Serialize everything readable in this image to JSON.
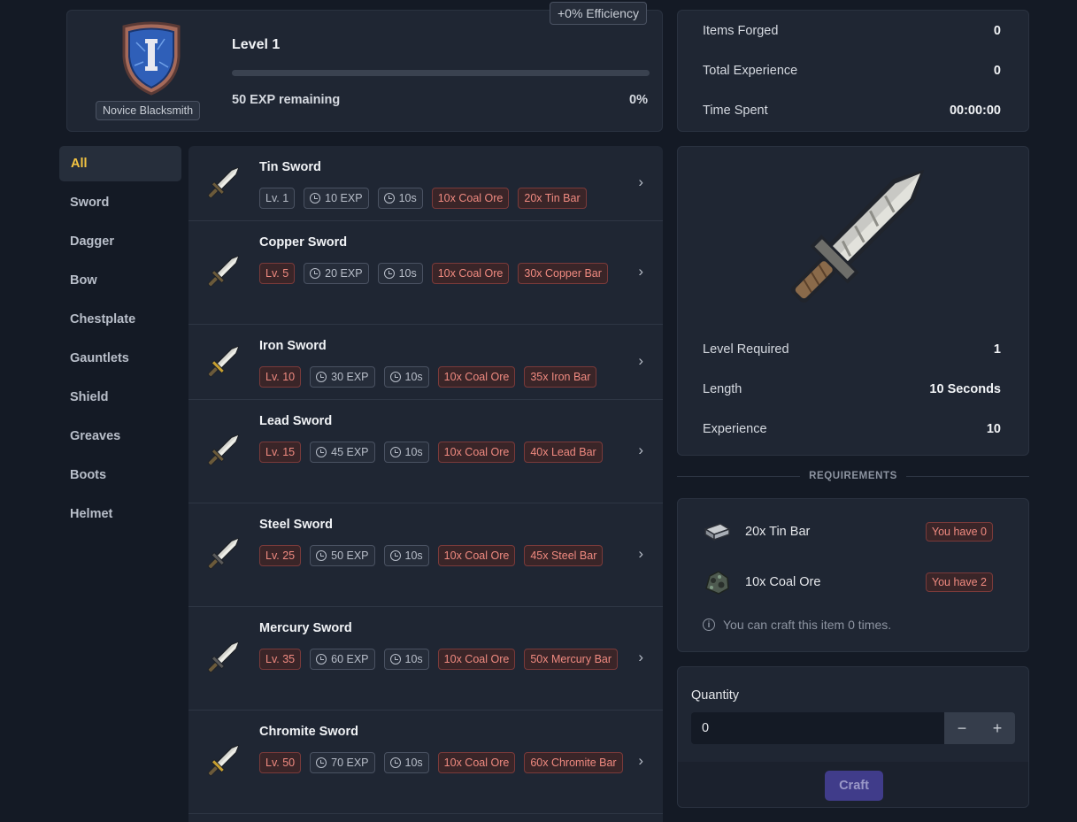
{
  "level": {
    "title": "Level 1",
    "rank": "Novice Blacksmith",
    "exp_remaining": "50 EXP remaining",
    "progress_label": "0%",
    "progress_fraction": 0,
    "efficiency": "+0% Efficiency"
  },
  "stats": {
    "items_forged_label": "Items Forged",
    "items_forged": "0",
    "total_exp_label": "Total Experience",
    "total_exp": "0",
    "time_spent_label": "Time Spent",
    "time_spent": "00:00:00"
  },
  "categories": [
    "All",
    "Sword",
    "Dagger",
    "Bow",
    "Chestplate",
    "Gauntlets",
    "Shield",
    "Greaves",
    "Boots",
    "Helmet"
  ],
  "active_category": "All",
  "recipes": [
    {
      "name": "Tin Sword",
      "level": "Lv. 1",
      "level_met": true,
      "exp": "10 EXP",
      "time": "10s",
      "materials": [
        "10x Coal Ore",
        "20x Tin Bar"
      ],
      "hilt_color": "#6b5a3a"
    },
    {
      "name": "Copper Sword",
      "level": "Lv. 5",
      "level_met": false,
      "exp": "20 EXP",
      "time": "10s",
      "materials": [
        "10x Coal Ore",
        "30x Copper Bar"
      ],
      "hilt_color": "#6b5a3a"
    },
    {
      "name": "Iron Sword",
      "level": "Lv. 10",
      "level_met": false,
      "exp": "30 EXP",
      "time": "10s",
      "materials": [
        "10x Coal Ore",
        "35x Iron Bar"
      ],
      "hilt_color": "#c8a030"
    },
    {
      "name": "Lead Sword",
      "level": "Lv. 15",
      "level_met": false,
      "exp": "45 EXP",
      "time": "10s",
      "materials": [
        "10x Coal Ore",
        "40x Lead Bar"
      ],
      "hilt_color": "#6b5a3a"
    },
    {
      "name": "Steel Sword",
      "level": "Lv. 25",
      "level_met": false,
      "exp": "50 EXP",
      "time": "10s",
      "materials": [
        "10x Coal Ore",
        "45x Steel Bar"
      ],
      "hilt_color": "#5a5a5a"
    },
    {
      "name": "Mercury Sword",
      "level": "Lv. 35",
      "level_met": false,
      "exp": "60 EXP",
      "time": "10s",
      "materials": [
        "10x Coal Ore",
        "50x Mercury Bar"
      ],
      "hilt_color": "#5a5a5a"
    },
    {
      "name": "Chromite Sword",
      "level": "Lv. 50",
      "level_met": false,
      "exp": "70 EXP",
      "time": "10s",
      "materials": [
        "10x Coal Ore",
        "60x Chromite Bar"
      ],
      "hilt_color": "#c8a030"
    }
  ],
  "detail": {
    "level_required_label": "Level Required",
    "level_required": "1",
    "length_label": "Length",
    "length": "10 Seconds",
    "experience_label": "Experience",
    "experience": "10"
  },
  "requirements": {
    "heading": "REQUIREMENTS",
    "items": [
      {
        "label": "20x Tin Bar",
        "have": "You have 0",
        "icon": "tin-bar-icon"
      },
      {
        "label": "10x Coal Ore",
        "have": "You have 2",
        "icon": "coal-ore-icon"
      }
    ],
    "craft_info": "You can craft this item 0 times."
  },
  "quantity": {
    "label": "Quantity",
    "value": "0",
    "minus": "−",
    "plus": "+",
    "craft_label": "Craft"
  },
  "colors": {
    "accent": "#f5c542",
    "danger_text": "#f08a80",
    "craft_button": "#403c8a"
  }
}
